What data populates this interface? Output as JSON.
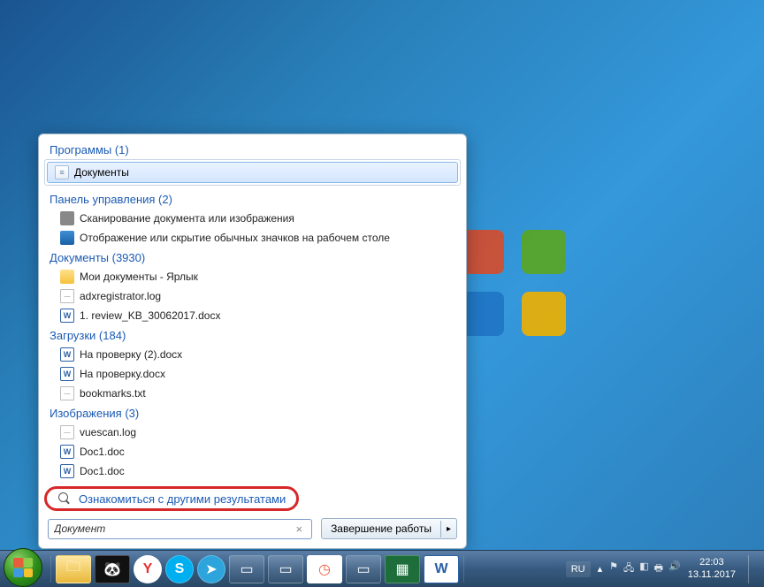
{
  "categories": {
    "programs": {
      "label": "Программы (1)",
      "items": [
        {
          "name": "Документы",
          "icon": "doc"
        }
      ]
    },
    "control_panel": {
      "label": "Панель управления (2)",
      "items": [
        {
          "name": "Сканирование документа или изображения",
          "icon": "scanner"
        },
        {
          "name": "Отображение или скрытие обычных значков на рабочем столе",
          "icon": "display"
        }
      ]
    },
    "documents": {
      "label": "Документы (3930)",
      "items": [
        {
          "name": "Мои документы - Ярлык",
          "icon": "folder"
        },
        {
          "name": "adxregistrator.log",
          "icon": "txt"
        },
        {
          "name": "1. review_KB_30062017.docx",
          "icon": "word"
        }
      ]
    },
    "downloads": {
      "label": "Загрузки (184)",
      "items": [
        {
          "name": "На проверку (2).docx",
          "icon": "word"
        },
        {
          "name": "На проверку.docx",
          "icon": "word"
        },
        {
          "name": "bookmarks.txt",
          "icon": "txt"
        }
      ]
    },
    "images": {
      "label": "Изображения (3)",
      "items": [
        {
          "name": "vuescan.log",
          "icon": "txt"
        },
        {
          "name": "Doc1.doc",
          "icon": "word"
        },
        {
          "name": "Doc1.doc",
          "icon": "word"
        }
      ]
    }
  },
  "more_results": "Ознакомиться с другими результатами",
  "search": {
    "value": "Документ",
    "clear": "×"
  },
  "shutdown": {
    "label": "Завершение работы",
    "arrow": "▸"
  },
  "tray": {
    "lang": "RU",
    "up": "▴",
    "time": "22:03",
    "date": "13.11.2017"
  },
  "taskbar_items": [
    {
      "key": "explorer",
      "glyph": "🗀"
    },
    {
      "key": "panda",
      "glyph": "🐼"
    },
    {
      "key": "yandex",
      "glyph": "Y"
    },
    {
      "key": "skype",
      "glyph": "S"
    },
    {
      "key": "telegram",
      "glyph": "➤"
    },
    {
      "key": "generic1",
      "glyph": "▭"
    },
    {
      "key": "generic2",
      "glyph": "▭"
    },
    {
      "key": "clock",
      "glyph": "◷"
    },
    {
      "key": "generic3",
      "glyph": "▭"
    },
    {
      "key": "monitor",
      "glyph": "▦"
    },
    {
      "key": "word-tb",
      "glyph": "W"
    }
  ]
}
